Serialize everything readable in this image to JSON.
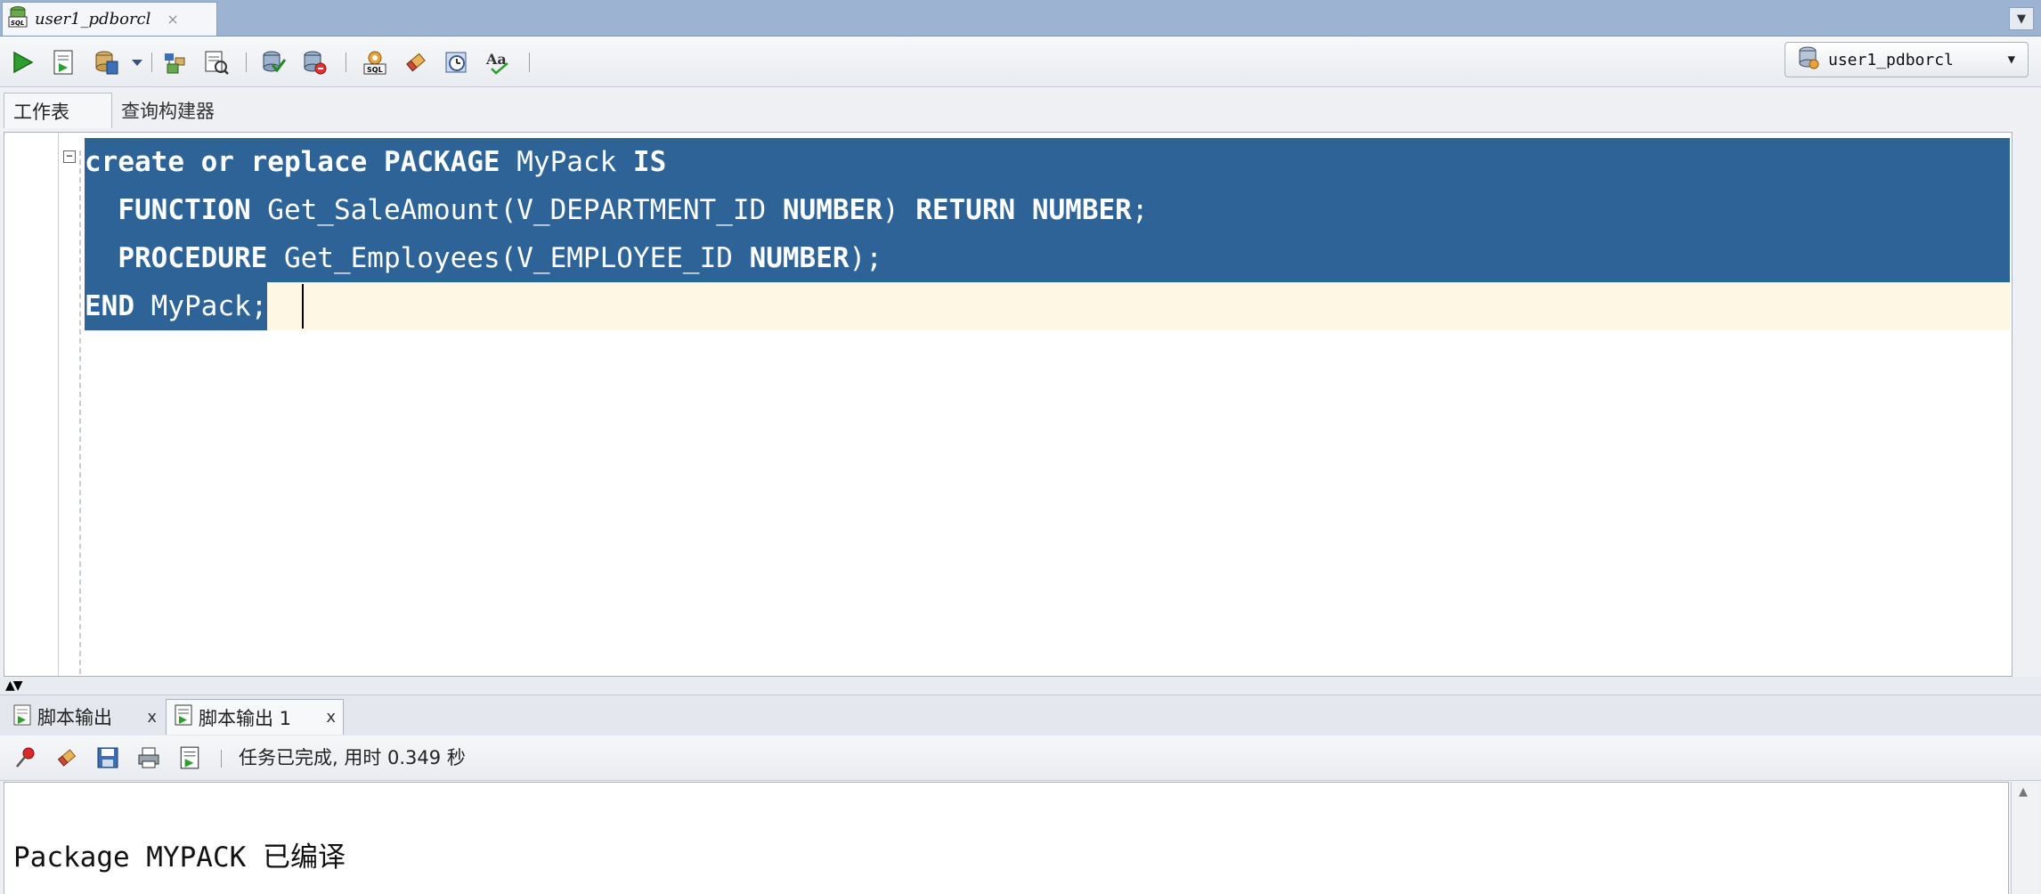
{
  "window": {
    "tab_title": "user1_pdborcl",
    "tab_close": "×",
    "menu_glyph": "▼"
  },
  "toolbar": {
    "buttons": [
      "run-statement-icon",
      "run-script-icon",
      "commit-icon",
      "dropdown-arrow-icon",
      "autotrace-icon",
      "explain-plan-icon",
      "commit-transaction-icon",
      "rollback-icon",
      "sql-tuning-icon",
      "clear-eraser-icon",
      "history-clock-icon",
      "format-text-icon"
    ],
    "connection": "user1_pdborcl",
    "connection_arrow": "▼"
  },
  "subtabs": {
    "worksheet": "工作表",
    "query_builder": "查询构建器"
  },
  "editor": {
    "fold_glyph": "−",
    "lines": [
      {
        "segments": [
          {
            "t": "create or replace PACKAGE",
            "k": true
          },
          {
            "t": " MyPack ",
            "k": false
          },
          {
            "t": "IS",
            "k": true
          }
        ]
      },
      {
        "segments": [
          {
            "t": "  ",
            "k": false
          },
          {
            "t": "FUNCTION",
            "k": true
          },
          {
            "t": " Get_SaleAmount(V_DEPARTMENT_ID ",
            "k": false
          },
          {
            "t": "NUMBER",
            "k": true
          },
          {
            "t": ") ",
            "k": false
          },
          {
            "t": "RETURN",
            "k": true
          },
          {
            "t": " ",
            "k": false
          },
          {
            "t": "NUMBER",
            "k": true
          },
          {
            "t": ";",
            "k": false
          }
        ]
      },
      {
        "segments": [
          {
            "t": "  ",
            "k": false
          },
          {
            "t": "PROCEDURE",
            "k": true
          },
          {
            "t": " Get_Employees(V_EMPLOYEE_ID ",
            "k": false
          },
          {
            "t": "NUMBER",
            "k": true
          },
          {
            "t": ");",
            "k": false
          }
        ]
      },
      {
        "segments": [
          {
            "t": "END",
            "k": true
          },
          {
            "t": " MyPack;",
            "k": false
          }
        ]
      }
    ],
    "selection_color": "#2d6397",
    "current_line_color": "#fdf7e4"
  },
  "output_tabs": {
    "tab1": "脚本输出",
    "tab2": "脚本输出 1",
    "close": "x"
  },
  "output_toolbar": {
    "buttons": [
      "pin-icon",
      "clear-eraser-icon",
      "save-icon",
      "print-icon",
      "script-output-icon"
    ],
    "status": "任务已完成, 用时 0.349 秒"
  },
  "output": {
    "text": "Package MYPACK 已编译"
  },
  "splitter": {
    "arrows": "▲▼"
  }
}
